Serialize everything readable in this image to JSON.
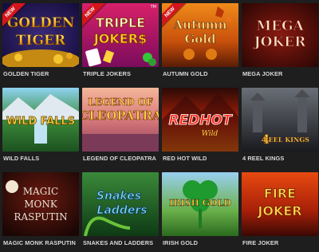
{
  "games": [
    {
      "id": "golden-tiger",
      "title": "GOLDEN TIGER",
      "logo_line1": "GOLDEN",
      "logo_line2": "TIGER",
      "badge": "NEW"
    },
    {
      "id": "triple-jokers",
      "title": "TRIPLE JOKERS",
      "logo_line1": "TRIPLE",
      "logo_line2": "JOKER$",
      "badge": "NEW",
      "tm": "TM"
    },
    {
      "id": "autumn-gold",
      "title": "AUTUMN GOLD",
      "logo_line1": "Autumn",
      "logo_line2": "Gold",
      "badge": "NEW"
    },
    {
      "id": "mega-joker",
      "title": "MEGA JOKER",
      "logo_line1": "MEGA",
      "logo_line2": "JOKER"
    },
    {
      "id": "wild-falls",
      "title": "WILD FALLS",
      "logo_line1": "WILD FALLS"
    },
    {
      "id": "legend-of-cleopatra",
      "title": "LEGEND OF CLEOPATRA",
      "logo_line1": "LEGEND OF",
      "logo_line2": "CLEOPATRA"
    },
    {
      "id": "red-hot-wild",
      "title": "RED HOT WILD",
      "logo_line1": "REDHOT",
      "logo_line2": "Wild"
    },
    {
      "id": "4-reel-kings",
      "title": "4 REEL KINGS",
      "logo_line1": "4",
      "logo_line2": "REEL KINGS"
    },
    {
      "id": "magic-monk-rasputin",
      "title": "MAGIC MONK RASPUTIN",
      "logo_line1": "MAGIC",
      "logo_line2": "MONK",
      "logo_line3": "RASPUTIN"
    },
    {
      "id": "snakes-and-ladders",
      "title": "SNAKES AND LADDERS",
      "logo_line1": "Snakes",
      "logo_line2": "Ladders"
    },
    {
      "id": "irish-gold",
      "title": "IRISH GOLD",
      "logo_line1": "IRISH GOLD"
    },
    {
      "id": "fire-joker",
      "title": "FIRE JOKER",
      "logo_line1": "FIRE",
      "logo_line2": "JOKER"
    }
  ],
  "colors": {
    "background": "#1e1e1e",
    "caption": "#d8d8d8",
    "badge": "#d4161c"
  }
}
